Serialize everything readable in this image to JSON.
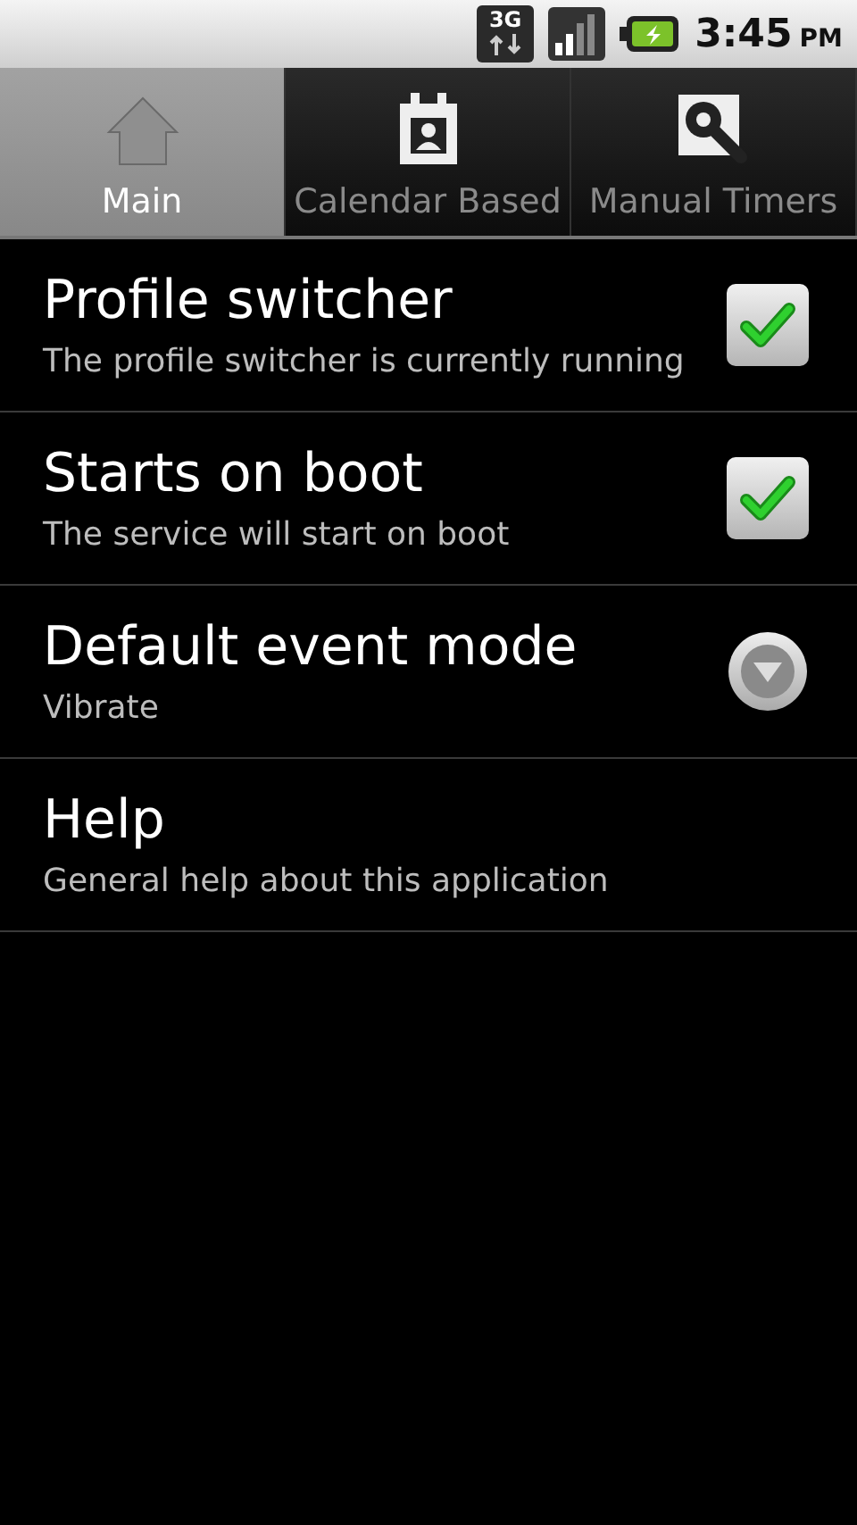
{
  "status_bar": {
    "network": "3G",
    "time": "3:45",
    "ampm": "PM"
  },
  "tabs": [
    {
      "label": "Main",
      "selected": true
    },
    {
      "label": "Calendar Based",
      "selected": false
    },
    {
      "label": "Manual Timers",
      "selected": false
    }
  ],
  "settings": [
    {
      "kind": "checkbox",
      "title": "Profile switcher",
      "summary": "The profile switcher is currently running",
      "checked": true
    },
    {
      "kind": "checkbox",
      "title": "Starts on boot",
      "summary": "The service will start on boot",
      "checked": true
    },
    {
      "kind": "dropdown",
      "title": "Default event mode",
      "summary": "Vibrate"
    },
    {
      "kind": "plain",
      "title": "Help",
      "summary": "General help about this application"
    }
  ]
}
